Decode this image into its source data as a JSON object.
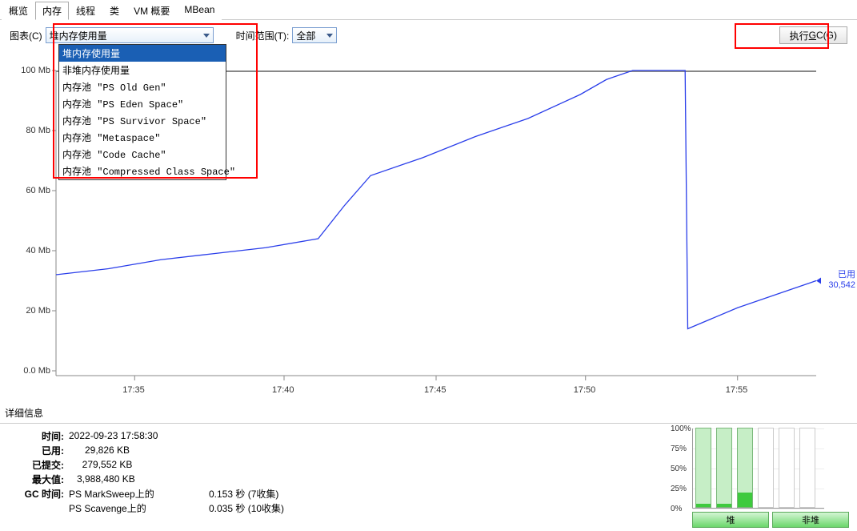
{
  "tabs": [
    "概览",
    "内存",
    "线程",
    "类",
    "VM 概要",
    "MBean"
  ],
  "active_tab": "内存",
  "toolbar": {
    "chart_label": "图表(C)",
    "chart_select_value": "堆内存使用量",
    "time_label": "时间范围(T):",
    "time_select_value": "全部",
    "gc_button_prefix": "执行 ",
    "gc_button_u": "G",
    "gc_button_rest": "C(G)"
  },
  "dropdown_options": [
    "堆内存使用量",
    "非堆内存使用量",
    "内存池 \"PS Old Gen\"",
    "内存池 \"PS Eden Space\"",
    "内存池 \"PS Survivor Space\"",
    "内存池 \"Metaspace\"",
    "内存池 \"Code Cache\"",
    "内存池 \"Compressed Class Space\""
  ],
  "dropdown_selected": 0,
  "side_annotation": {
    "label": "已用",
    "value": "30,542"
  },
  "details": {
    "header": "详细信息",
    "rows": [
      {
        "k": "时间:",
        "v": "2022-09-23 17:58:30"
      },
      {
        "k": "已用:",
        "v": "      29,826 KB"
      },
      {
        "k": "已提交:",
        "v": "     279,552 KB"
      },
      {
        "k": "最大值:",
        "v": "   3,988,480 KB"
      }
    ],
    "gc": [
      {
        "k": "GC 时间:",
        "n": "PS MarkSweep上的",
        "t": "0.153 秒 (7收集)"
      },
      {
        "k": "",
        "n": "PS Scavenge上的",
        "t": "0.035 秒 (10收集)"
      }
    ]
  },
  "mini": {
    "y_ticks": [
      "100%",
      "75%",
      "50%",
      "25%",
      "0%"
    ],
    "bars": [
      {
        "height": 100,
        "fill": 4,
        "cls": ""
      },
      {
        "height": 100,
        "fill": 4,
        "cls": ""
      },
      {
        "height": 100,
        "fill": 18,
        "cls": ""
      },
      {
        "height": 100,
        "fill": 0,
        "cls": "empty"
      },
      {
        "height": 100,
        "fill": 0,
        "cls": "empty"
      },
      {
        "height": 100,
        "fill": 0,
        "cls": "empty"
      }
    ],
    "btn_heap": "堆",
    "btn_nonheap": "非堆"
  },
  "chart_data": {
    "type": "line",
    "title": "",
    "xlabel": "",
    "ylabel": "Mb",
    "ylim": [
      0,
      100
    ],
    "x_ticks": [
      "17:35",
      "17:40",
      "17:45",
      "17:50",
      "17:55"
    ],
    "y_ticks": [
      0.0,
      20,
      40,
      60,
      80,
      100
    ],
    "series": [
      {
        "name": "已用",
        "color": "#2a3eea",
        "x": [
          0,
          2,
          4,
          6,
          8,
          10,
          11,
          12,
          14,
          16,
          18,
          20,
          21,
          22,
          23,
          24,
          24.1,
          26,
          28,
          29
        ],
        "y": [
          32,
          34,
          37,
          39,
          41,
          44,
          55,
          65,
          71,
          78,
          84,
          92,
          97,
          100,
          100,
          100,
          14,
          21,
          27,
          30
        ]
      }
    ],
    "y_tick_labels": [
      "0.0 Mb",
      "20 Mb",
      "40 Mb",
      "60 Mb",
      "80 Mb",
      "100 Mb"
    ]
  }
}
